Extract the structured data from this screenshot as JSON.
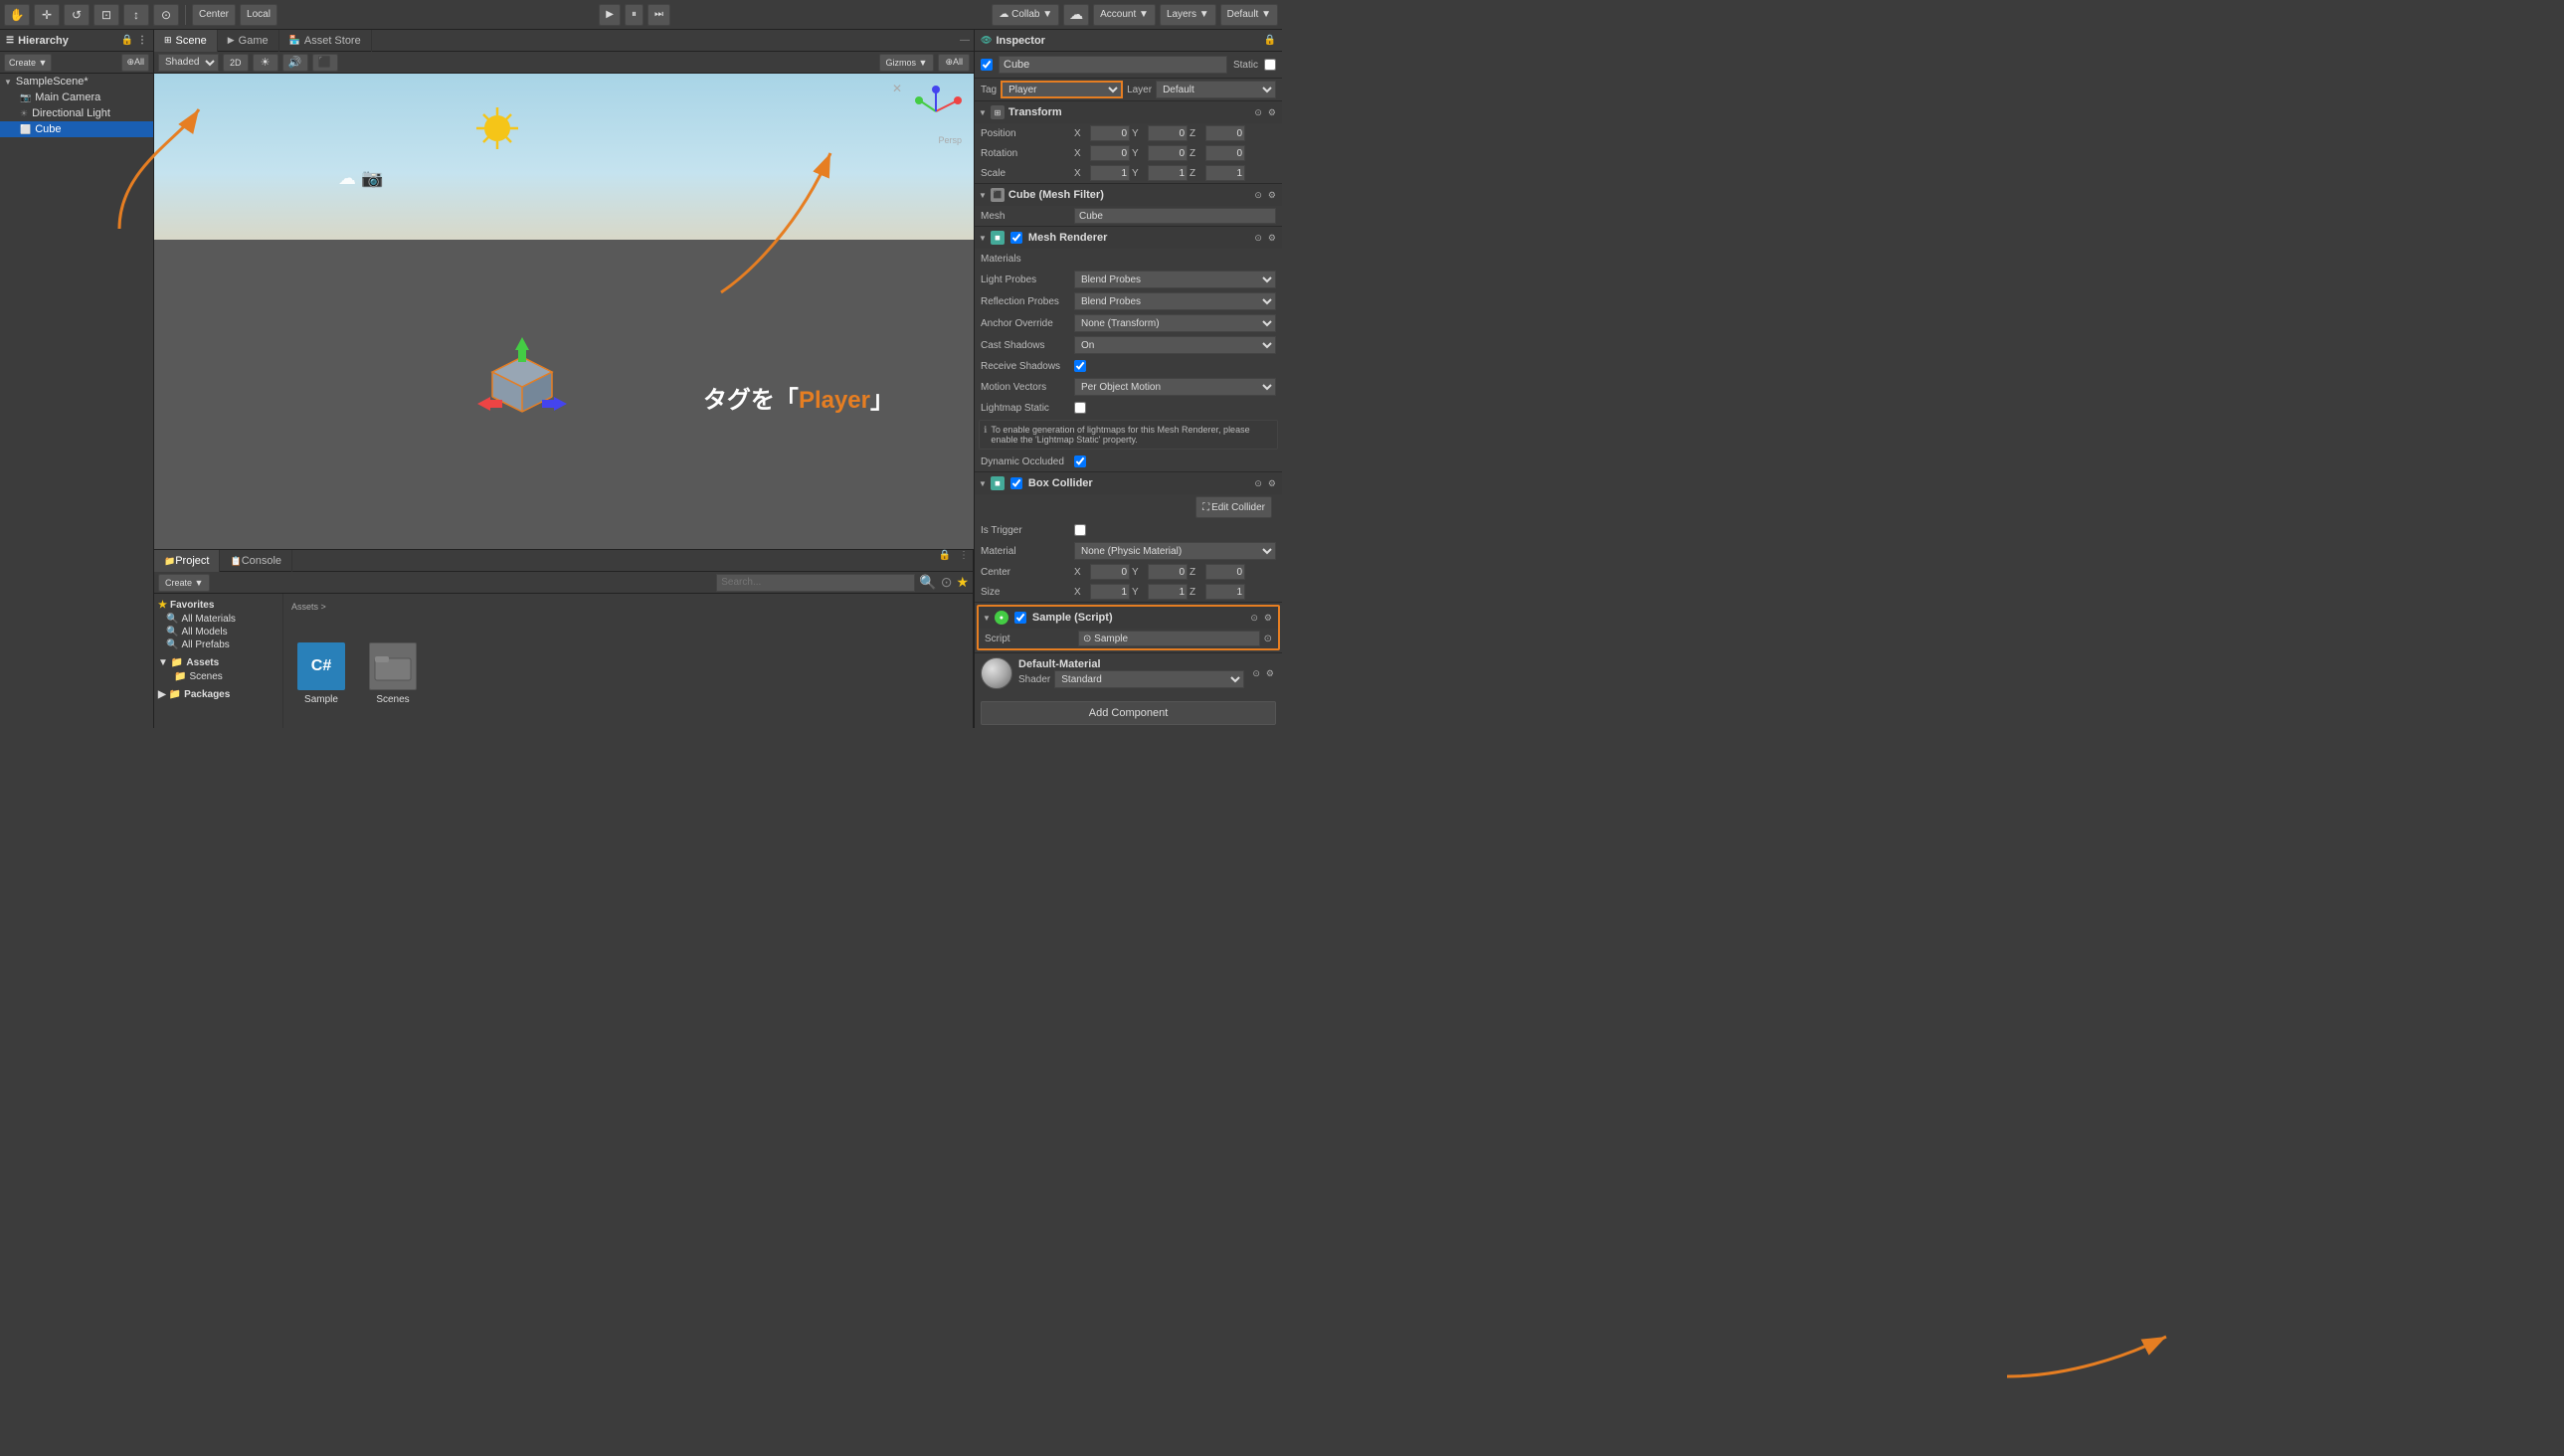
{
  "toolbar": {
    "tools": [
      "✋",
      "✛",
      "↺",
      "⊡",
      "↕",
      "⊙"
    ],
    "center_label": "Center",
    "local_label": "Local",
    "play_label": "▶",
    "pause_label": "⏸",
    "step_label": "⏭",
    "collab_label": "Collab ▼",
    "account_label": "Account ▼",
    "layers_label": "Layers ▼",
    "default_label": "Default ▼"
  },
  "hierarchy": {
    "title": "Hierarchy",
    "create_label": "Create ▼",
    "all_label": "⊕All",
    "scene_name": "SampleScene*",
    "items": [
      {
        "label": "Main Camera",
        "type": "camera",
        "indent": 1
      },
      {
        "label": "Directional Light",
        "type": "light",
        "indent": 1
      },
      {
        "label": "Cube",
        "type": "cube",
        "indent": 1,
        "selected": true
      }
    ]
  },
  "scene": {
    "tabs": [
      "Scene",
      "Game",
      "Asset Store"
    ],
    "active_tab": "Scene",
    "shading": "Shaded",
    "mode_2d": "2D",
    "gizmos_label": "Gizmos ▼",
    "all_label": "⊕All"
  },
  "annotation": {
    "text": "タグを「Player」",
    "white_part": "タグを「",
    "orange_part": "Player",
    "closing": "」"
  },
  "project": {
    "tabs": [
      "Project",
      "Console"
    ],
    "active_tab": "Project",
    "create_label": "Create ▼",
    "favorites_label": "Favorites",
    "favorites_items": [
      "All Materials",
      "All Models",
      "All Prefabs"
    ],
    "assets_label": "Assets",
    "assets_path": "Assets >",
    "assets_items": [
      {
        "name": "Scenes",
        "type": "folder"
      }
    ],
    "packages_label": "Packages",
    "files": [
      {
        "name": "Sample",
        "type": "cs"
      },
      {
        "name": "Scenes",
        "type": "folder"
      }
    ]
  },
  "inspector": {
    "title": "Inspector",
    "object_name": "Cube",
    "static_label": "Static",
    "tag_label": "Tag",
    "tag_value": "Player",
    "layer_label": "Layer",
    "layer_value": "Default",
    "transform": {
      "title": "Transform",
      "position": {
        "label": "Position",
        "x": "0",
        "y": "0",
        "z": "0"
      },
      "rotation": {
        "label": "Rotation",
        "x": "0",
        "y": "0",
        "z": "0"
      },
      "scale": {
        "label": "Scale",
        "x": "1",
        "y": "1",
        "z": "1"
      }
    },
    "mesh_filter": {
      "title": "Cube (Mesh Filter)",
      "mesh_label": "Mesh",
      "mesh_value": "Cube"
    },
    "mesh_renderer": {
      "title": "Mesh Renderer",
      "materials_label": "Materials",
      "light_probes_label": "Light Probes",
      "light_probes_value": "Blend Probes",
      "reflection_probes_label": "Reflection Probes",
      "reflection_probes_value": "Blend Probes",
      "anchor_override_label": "Anchor Override",
      "anchor_override_value": "None (Transform)",
      "cast_shadows_label": "Cast Shadows",
      "cast_shadows_value": "On",
      "receive_shadows_label": "Receive Shadows",
      "motion_vectors_label": "Motion Vectors",
      "motion_vectors_value": "Per Object Motion",
      "lightmap_static_label": "Lightmap Static",
      "info_text": "To enable generation of lightmaps for this Mesh Renderer, please enable the 'Lightmap Static' property.",
      "dynamic_occluded_label": "Dynamic Occluded"
    },
    "box_collider": {
      "title": "Box Collider",
      "edit_label": "Edit Collider",
      "is_trigger_label": "Is Trigger",
      "material_label": "Material",
      "material_value": "None (Physic Material)",
      "center_label": "Center",
      "center_x": "0",
      "center_y": "0",
      "center_z": "0",
      "size_label": "Size",
      "size_x": "1",
      "size_y": "1",
      "size_z": "1"
    },
    "sample_script": {
      "title": "Sample (Script)",
      "script_label": "Script",
      "script_value": "Sample"
    },
    "material": {
      "name": "Default-Material",
      "shader_label": "Shader",
      "shader_value": "Standard"
    },
    "add_component_label": "Add Component"
  }
}
